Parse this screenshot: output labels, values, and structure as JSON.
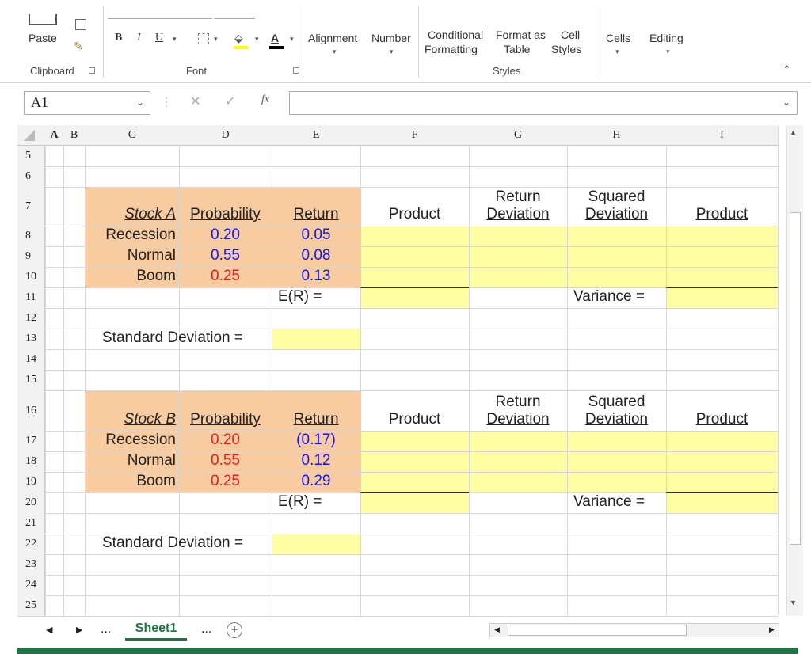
{
  "ribbon": {
    "paste": "Paste",
    "bold": "B",
    "italic": "I",
    "underline": "U",
    "font_color_letter": "A",
    "alignment": "Alignment",
    "number": "Number",
    "conditional_1": "Conditional",
    "conditional_2": "Formatting",
    "format_as_1": "Format as",
    "format_as_2": "Table",
    "cell_styles_1": "Cell",
    "cell_styles_2": "Styles",
    "cells": "Cells",
    "editing": "Editing",
    "groups": {
      "clipboard": "Clipboard",
      "font": "Font",
      "styles": "Styles"
    }
  },
  "formula_bar": {
    "name_box": "A1",
    "fx": "fx",
    "value": ""
  },
  "columns": [
    "A",
    "B",
    "C",
    "D",
    "E",
    "F",
    "G",
    "H",
    "I"
  ],
  "rows": [
    "5",
    "6",
    "7",
    "8",
    "9",
    "10",
    "11",
    "12",
    "13",
    "14",
    "15",
    "16",
    "17",
    "18",
    "19",
    "20",
    "21",
    "22",
    "23",
    "24",
    "25"
  ],
  "stockA": {
    "title": "Stock A",
    "probability_header": "Probability",
    "return_header": "Return",
    "product_header": "Product",
    "return_dev_1": "Return",
    "return_dev_2": "Deviation",
    "sq_dev_1": "Squared",
    "sq_dev_2": "Deviation",
    "product2_header": "Product",
    "states": [
      {
        "name": "Recession",
        "prob": "0.20",
        "ret": "0.05"
      },
      {
        "name": "Normal",
        "prob": "0.55",
        "ret": "0.08"
      },
      {
        "name": "Boom",
        "prob": "0.25",
        "ret": "0.13"
      }
    ],
    "er_label": "E(R) =",
    "variance_label": "Variance =",
    "sd_label": "Standard Deviation ="
  },
  "stockB": {
    "title": "Stock B",
    "probability_header": "Probability",
    "return_header": "Return",
    "product_header": "Product",
    "return_dev_1": "Return",
    "return_dev_2": "Deviation",
    "sq_dev_1": "Squared",
    "sq_dev_2": "Deviation",
    "product2_header": "Product",
    "states": [
      {
        "name": "Recession",
        "prob": "0.20",
        "ret": "(0.17)"
      },
      {
        "name": "Normal",
        "prob": "0.55",
        "ret": "0.12"
      },
      {
        "name": "Boom",
        "prob": "0.25",
        "ret": "0.29"
      }
    ],
    "er_label": "E(R) =",
    "variance_label": "Variance =",
    "sd_label": "Standard Deviation ="
  },
  "sheet_tabs": {
    "ellipsis_left": "...",
    "active": "Sheet1",
    "ellipsis_right": "...",
    "add": "+"
  },
  "colors": {
    "input_fill": "#f8cba0",
    "answer_fill": "#ffffa5",
    "blue_text": "#1515ee",
    "red_text": "#e02020",
    "status_green": "#217346"
  }
}
